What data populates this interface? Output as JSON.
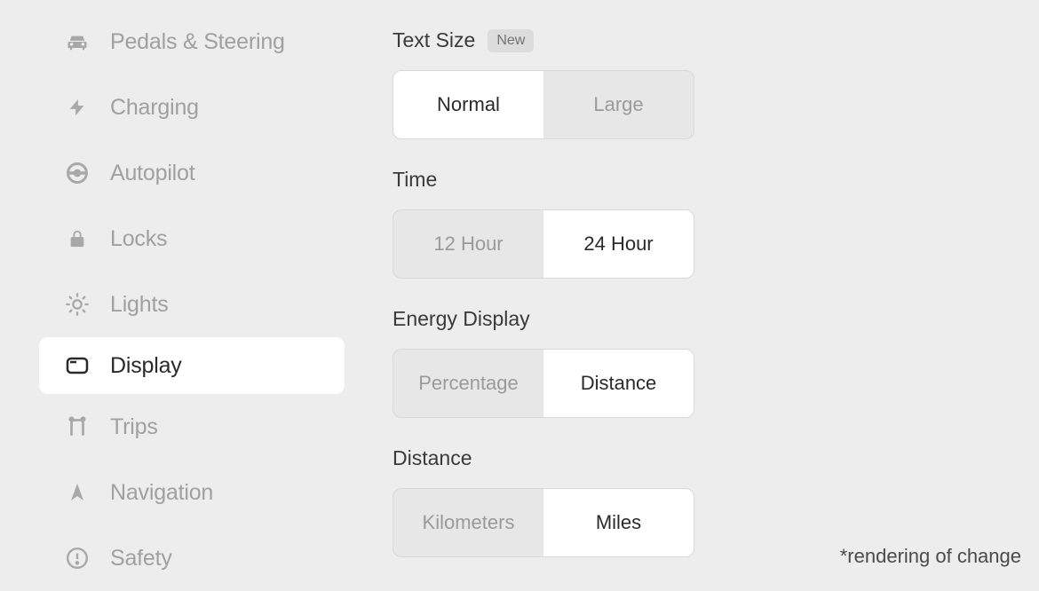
{
  "sidebar": {
    "items": [
      {
        "label": "Pedals & Steering",
        "icon": "car-icon",
        "active": false
      },
      {
        "label": "Charging",
        "icon": "bolt-icon",
        "active": false
      },
      {
        "label": "Autopilot",
        "icon": "steering-icon",
        "active": false
      },
      {
        "label": "Locks",
        "icon": "lock-icon",
        "active": false
      },
      {
        "label": "Lights",
        "icon": "sun-icon",
        "active": false
      },
      {
        "label": "Display",
        "icon": "display-icon",
        "active": true
      },
      {
        "label": "Trips",
        "icon": "route-icon",
        "active": false
      },
      {
        "label": "Navigation",
        "icon": "compass-icon",
        "active": false
      },
      {
        "label": "Safety",
        "icon": "alert-icon",
        "active": false
      }
    ]
  },
  "settings": {
    "text_size": {
      "title": "Text Size",
      "badge": "New",
      "options": [
        "Normal",
        "Large"
      ],
      "selected": "Normal"
    },
    "time": {
      "title": "Time",
      "options": [
        "12 Hour",
        "24 Hour"
      ],
      "selected": "24 Hour"
    },
    "energy_display": {
      "title": "Energy Display",
      "options": [
        "Percentage",
        "Distance"
      ],
      "selected": "Distance"
    },
    "distance": {
      "title": "Distance",
      "options": [
        "Kilometers",
        "Miles"
      ],
      "selected": "Miles"
    }
  },
  "footnote": "*rendering of change"
}
